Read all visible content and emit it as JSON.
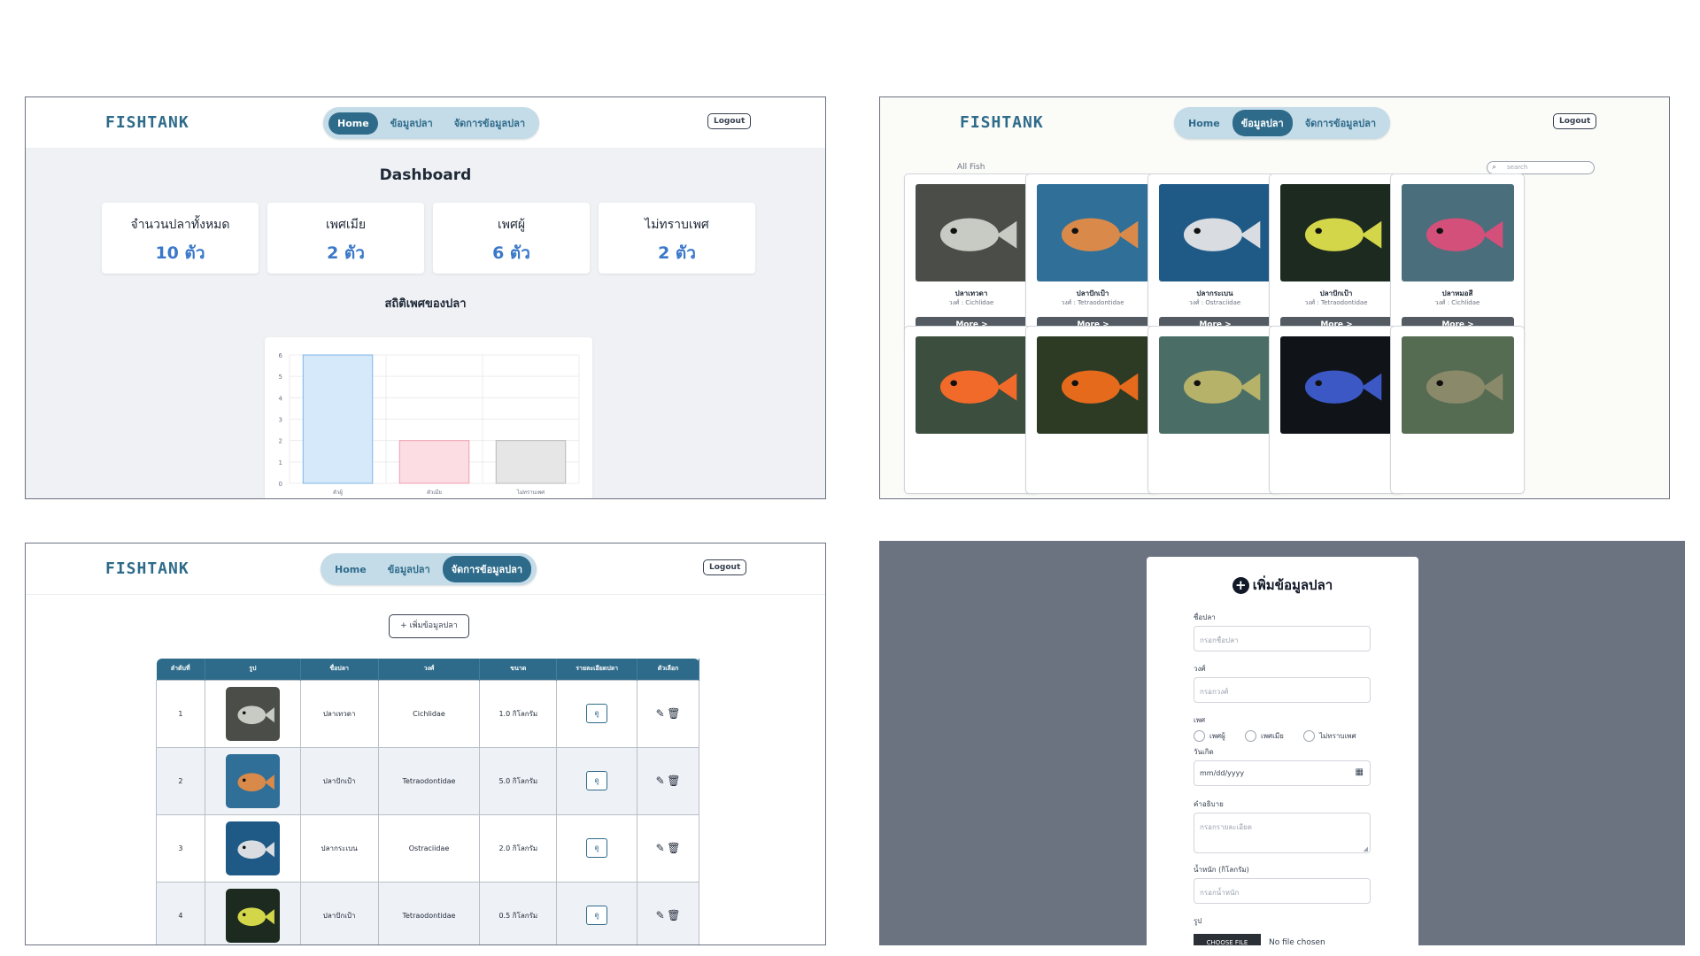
{
  "app": {
    "logo": "FISHTANK"
  },
  "nav": {
    "home": "Home",
    "fish_info": "ข้อมูลปลา",
    "manage": "จัดการข้อมูลปลา",
    "logout": "Logout"
  },
  "dashboard": {
    "title": "Dashboard",
    "stats": [
      {
        "label": "จำนวนปลาทั้งหมด",
        "value": "10 ตัว"
      },
      {
        "label": "เพศเมีย",
        "value": "2 ตัว"
      },
      {
        "label": "เพศผู้",
        "value": "6 ตัว"
      },
      {
        "label": "ไม่ทราบเพศ",
        "value": "2 ตัว"
      }
    ],
    "chart_title": "สถิติเพศของปลา"
  },
  "chart_data": {
    "type": "bar",
    "categories": [
      "ตัวผู้",
      "ตัวเมีย",
      "ไม่ทราบเพศ"
    ],
    "values": [
      6,
      2,
      2
    ],
    "colors": [
      "#d6e9fb",
      "#fcdde3",
      "#e6e6e6"
    ],
    "border_colors": [
      "#7fb5e6",
      "#f0a0b0",
      "#b8b8b8"
    ],
    "ylim": [
      0,
      6
    ],
    "yticks": [
      "0",
      "1",
      "2",
      "3",
      "4",
      "5",
      "6"
    ],
    "grid": true
  },
  "gallery": {
    "section_label": "All Fish",
    "search_placeholder": "search",
    "more_label": "More >",
    "cards": [
      {
        "name": "ปลาเทวดา",
        "family": "วงศ์ : Cichlidae",
        "bg": "#4b4e48",
        "fish": "#c8cbc4"
      },
      {
        "name": "ปลาปักเป้า",
        "family": "วงศ์ : Tetraodontidae",
        "bg": "#2f6f98",
        "fish": "#d98a4a"
      },
      {
        "name": "ปลากระเบน",
        "family": "วงศ์ : Ostraciidae",
        "bg": "#1f5a86",
        "fish": "#d9dde2"
      },
      {
        "name": "ปลาปักเป้า",
        "family": "วงศ์ : Tetraodontidae",
        "bg": "#1c2a20",
        "fish": "#d4d64a"
      },
      {
        "name": "ปลาหมอสี",
        "family": "วงศ์ : Cichlidae",
        "bg": "#4a6e7c",
        "fish": "#d2507a"
      },
      {
        "bg": "#3c4e3e",
        "fish": "#f26a2a"
      },
      {
        "bg": "#2d3a24",
        "fish": "#e56a1c"
      },
      {
        "bg": "#4a6e66",
        "fish": "#b7b26a"
      },
      {
        "bg": "#101318",
        "fish": "#3b58c4"
      },
      {
        "bg": "#556b52",
        "fish": "#8a8a6a"
      }
    ]
  },
  "manage": {
    "add_button": "+ เพิ่มข้อมูลปลา",
    "columns": [
      "ลำดับที่",
      "รูป",
      "ชื่อปลา",
      "วงศ์",
      "ขนาด",
      "รายละเอียดปลา",
      "ตัวเลือก"
    ],
    "detail_label": "ดู",
    "rows": [
      {
        "no": "1",
        "name": "ปลาเทวดา",
        "family": "Cichlidae",
        "size": "1.0 กิโลกรัม",
        "bg": "#4b4e48",
        "fish": "#c8cbc4"
      },
      {
        "no": "2",
        "name": "ปลาปักเป้า",
        "family": "Tetraodontidae",
        "size": "5.0 กิโลกรัม",
        "bg": "#2f6f98",
        "fish": "#d98a4a"
      },
      {
        "no": "3",
        "name": "ปลากระเบน",
        "family": "Ostraciidae",
        "size": "2.0 กิโลกรัม",
        "bg": "#1f5a86",
        "fish": "#d9dde2"
      },
      {
        "no": "4",
        "name": "ปลาปักเป้า",
        "family": "Tetraodontidae",
        "size": "0.5 กิโลกรัม",
        "bg": "#1c2a20",
        "fish": "#d4d64a"
      }
    ]
  },
  "form": {
    "title": "เพิ่มข้อมูลปลา",
    "name_label": "ชื่อปลา",
    "name_placeholder": "กรอกชื่อปลา",
    "family_label": "วงศ์",
    "family_placeholder": "กรอกวงศ์",
    "gender_label": "เพศ",
    "gender_options": [
      "เพศผู้",
      "เพศเมีย",
      "ไม่ทราบเพศ"
    ],
    "birth_label": "วันเกิด",
    "birth_placeholder": "mm/dd/yyyy",
    "desc_label": "คำอธิบาย",
    "desc_placeholder": "กรอกรายละเอียด",
    "weight_label": "น้ำหนัก (กิโลกรัม)",
    "weight_placeholder": "กรอกน้ำหนัก",
    "image_label": "รูป",
    "file_button": "CHOOSE FILE",
    "file_status": "No file chosen"
  }
}
